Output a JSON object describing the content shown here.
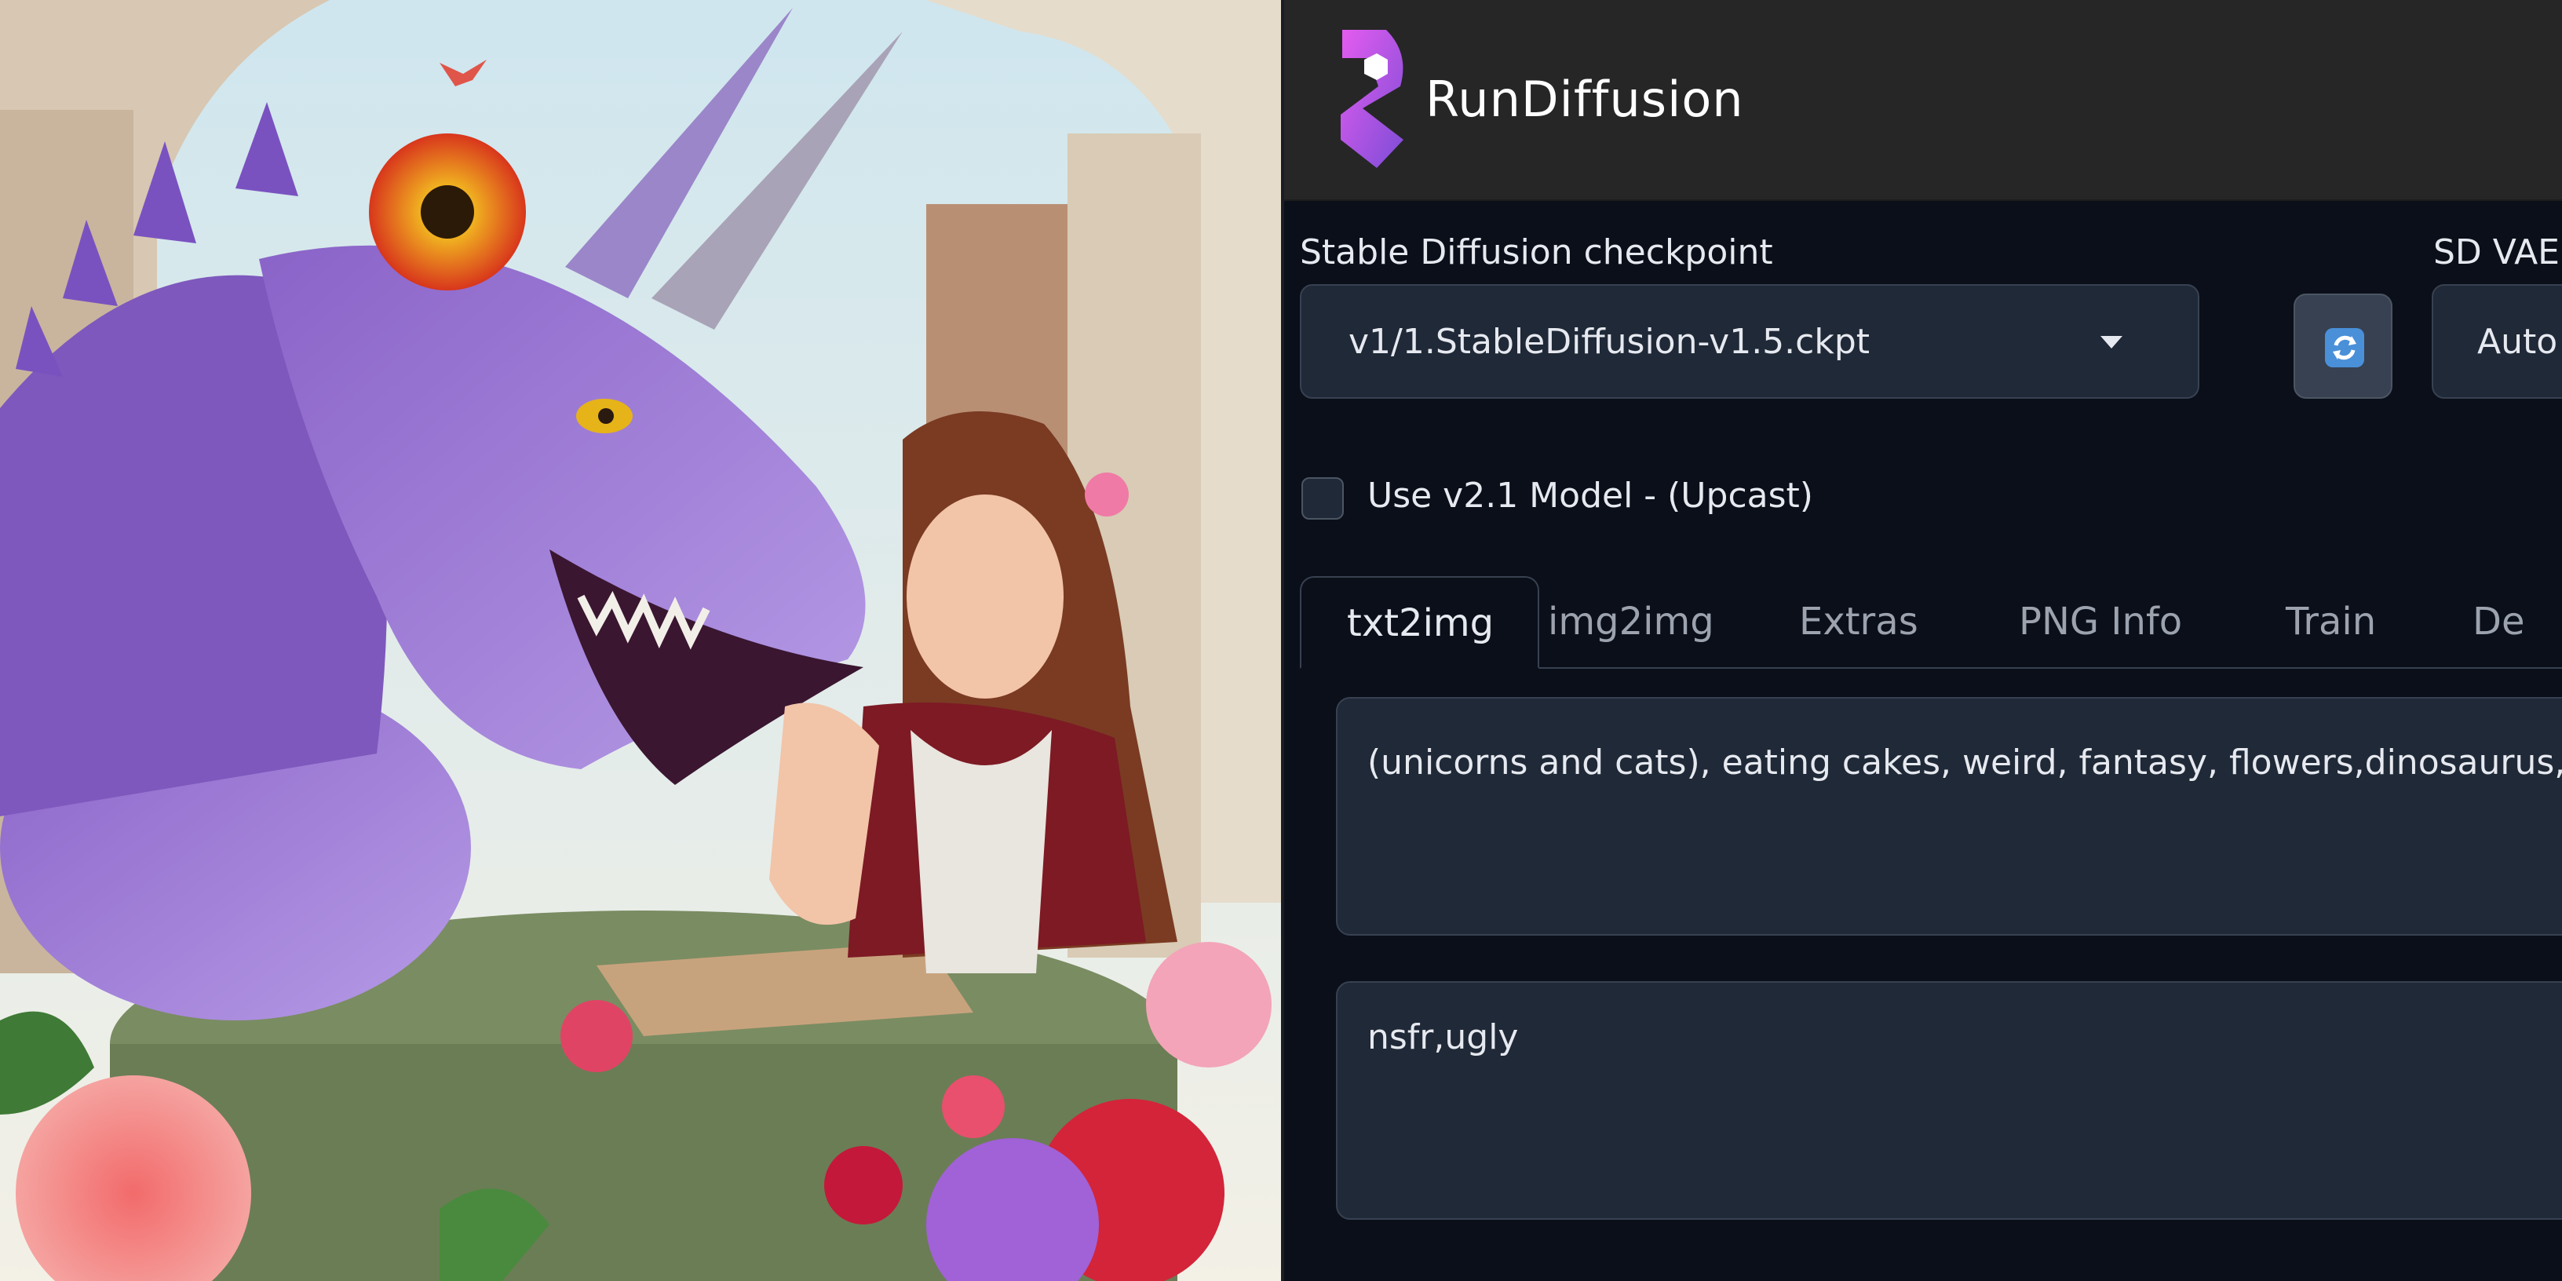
{
  "app": {
    "brand": "RunDiffusion"
  },
  "checkpoint": {
    "label": "Stable Diffusion checkpoint",
    "value": "v1/1.StableDiffusion-v1.5.ckpt"
  },
  "vae": {
    "label": "SD VAE",
    "value": "Auto"
  },
  "upcast": {
    "label": "Use v2.1 Model - (Upcast)",
    "checked": false
  },
  "tabs": [
    {
      "label": "txt2img",
      "active": true
    },
    {
      "label": "img2img"
    },
    {
      "label": "Extras"
    },
    {
      "label": "PNG Info"
    },
    {
      "label": "Train"
    },
    {
      "label": "De"
    }
  ],
  "prompt": {
    "value": "(unicorns and cats), eating cakes, weird, fantasy, flowers,dinosaurus, tea"
  },
  "negative_prompt": {
    "value": "nsfr,ugly"
  },
  "colors": {
    "background": "#0b0f19",
    "topbar": "#262626",
    "field": "#1f2937",
    "border": "#374151",
    "text": "#e6e9ef",
    "muted": "#9ca3af",
    "logo_gradient": [
      "#e55cf0",
      "#7b4dd6"
    ]
  },
  "icons": {
    "logo": "rundiffusion-logo-icon",
    "dropdown": "chevron-down-icon",
    "refresh": "refresh-icon"
  }
}
